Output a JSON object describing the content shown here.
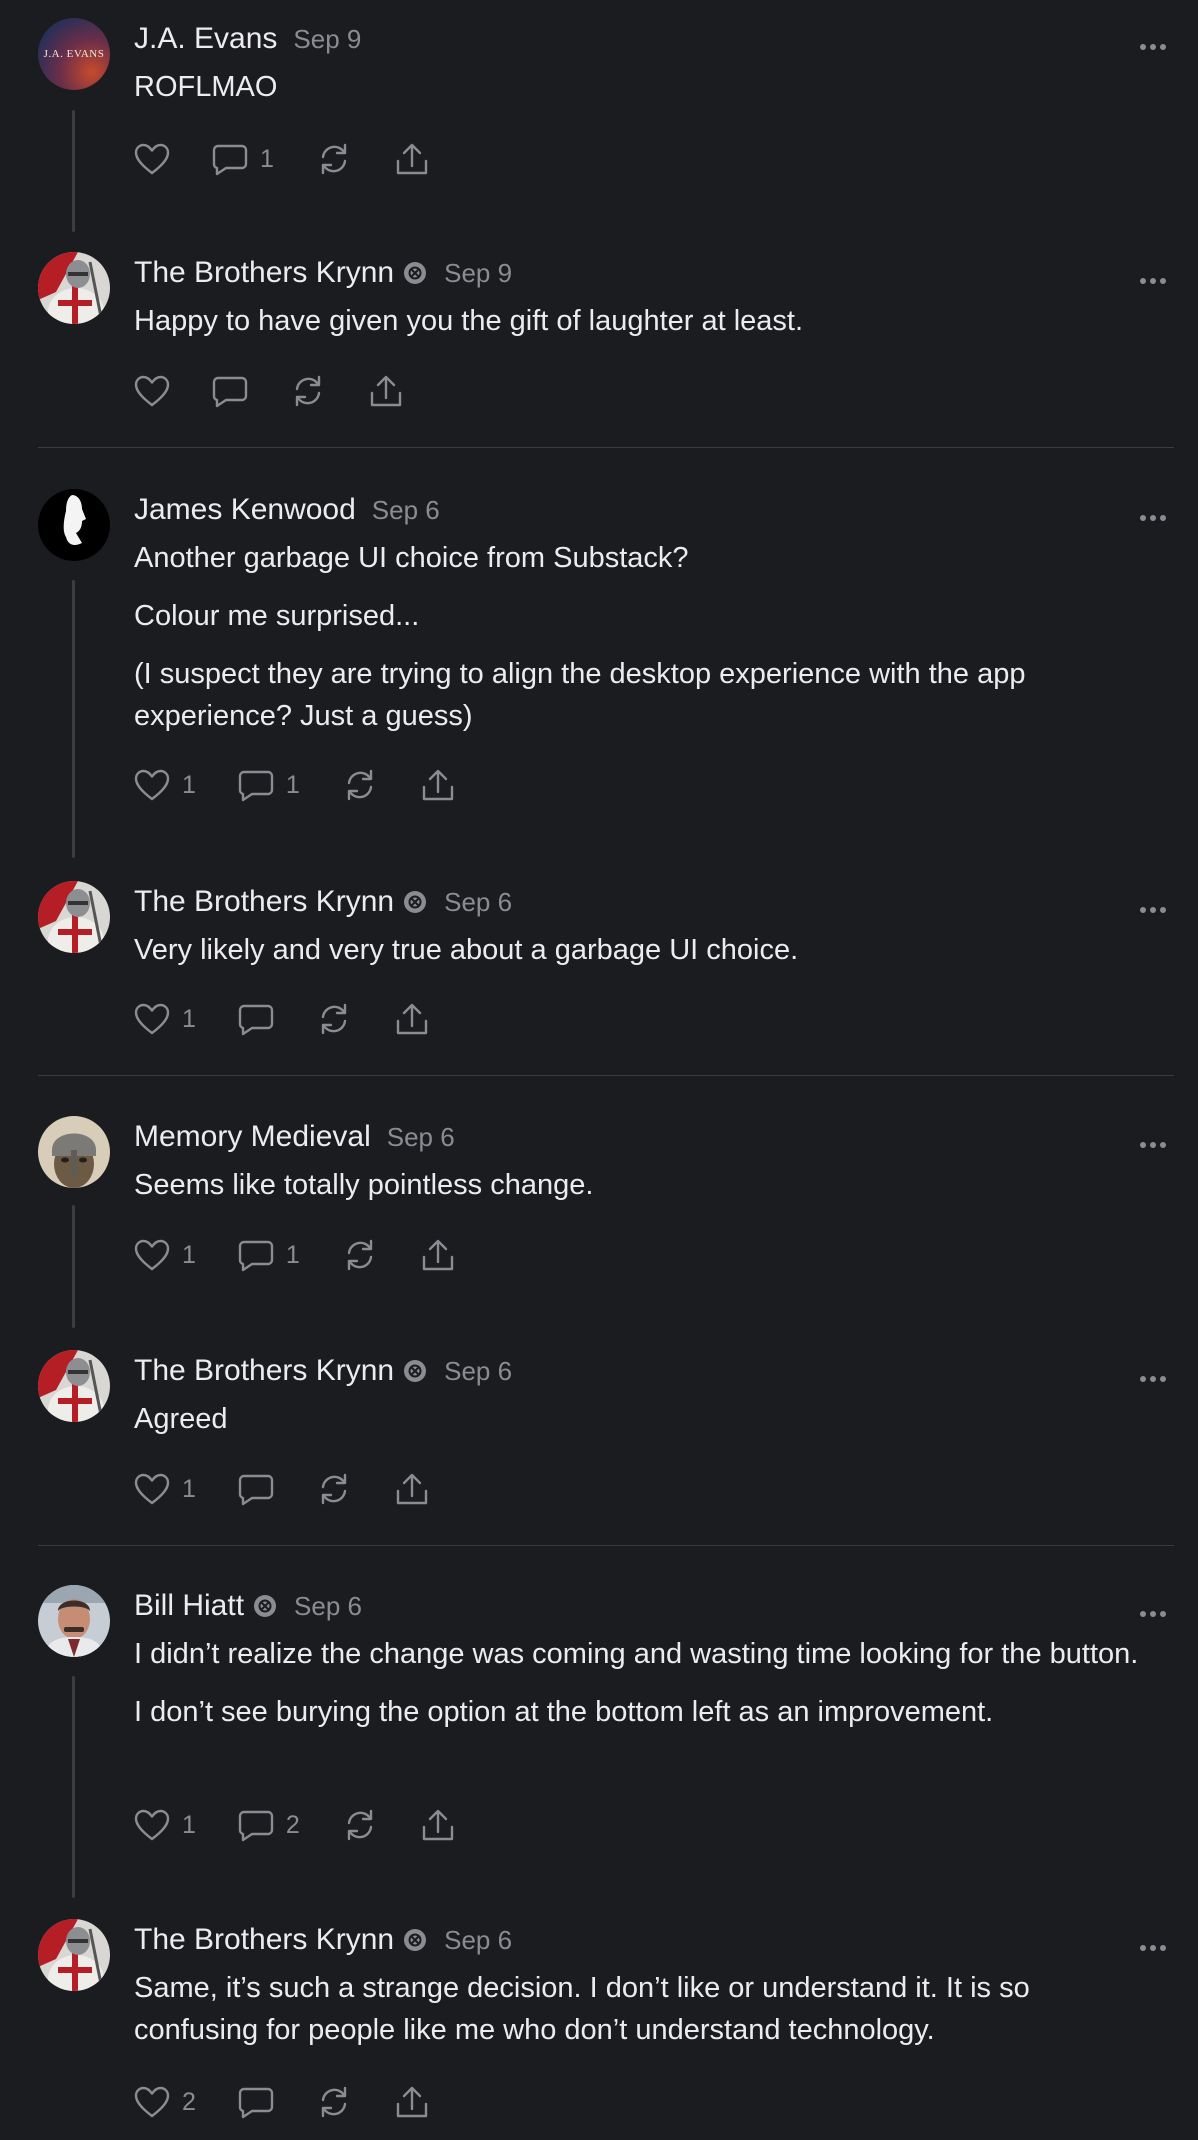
{
  "comments": [
    {
      "name": "J.A. Evans",
      "date": "Sep 9",
      "badge": false,
      "avatar": "jaevans",
      "avatar_text": "J.A. EVANS",
      "paragraphs": [
        "ROFLMAO"
      ],
      "likes": "",
      "replies": "1"
    },
    {
      "name": "The Brothers Krynn",
      "date": "Sep 9",
      "badge": true,
      "avatar": "knight",
      "paragraphs": [
        "Happy to have given you the gift of laughter at least."
      ],
      "likes": "",
      "replies": ""
    },
    {
      "name": "James Kenwood",
      "date": "Sep 6",
      "badge": false,
      "avatar": "silhouette",
      "paragraphs": [
        "Another garbage UI choice from Substack?",
        "Colour me surprised...",
        "(I suspect they are trying to align the desktop experience with the app experience? Just a guess)"
      ],
      "likes": "1",
      "replies": "1"
    },
    {
      "name": "The Brothers Krynn",
      "date": "Sep 6",
      "badge": true,
      "avatar": "knight",
      "paragraphs": [
        "Very likely and very true about a garbage UI choice."
      ],
      "likes": "1",
      "replies": ""
    },
    {
      "name": "Memory Medieval",
      "date": "Sep 6",
      "badge": false,
      "avatar": "helmet",
      "paragraphs": [
        "Seems like totally pointless change."
      ],
      "likes": "1",
      "replies": "1"
    },
    {
      "name": "The Brothers Krynn",
      "date": "Sep 6",
      "badge": true,
      "avatar": "knight",
      "paragraphs": [
        "Agreed"
      ],
      "likes": "1",
      "replies": ""
    },
    {
      "name": "Bill Hiatt",
      "date": "Sep 6",
      "badge": true,
      "avatar": "man",
      "paragraphs": [
        "I didn’t realize the change was coming and wasting time looking for the button.",
        "I don’t see burying the option at the bottom left as an improvement."
      ],
      "likes": "1",
      "replies": "2"
    },
    {
      "name": "The Brothers Krynn",
      "date": "Sep 6",
      "badge": true,
      "avatar": "knight",
      "paragraphs": [
        "Same, it’s such a strange decision. I don’t like or understand it. It is so confusing for people like me who don’t understand technology."
      ],
      "likes": "2",
      "replies": ""
    }
  ]
}
